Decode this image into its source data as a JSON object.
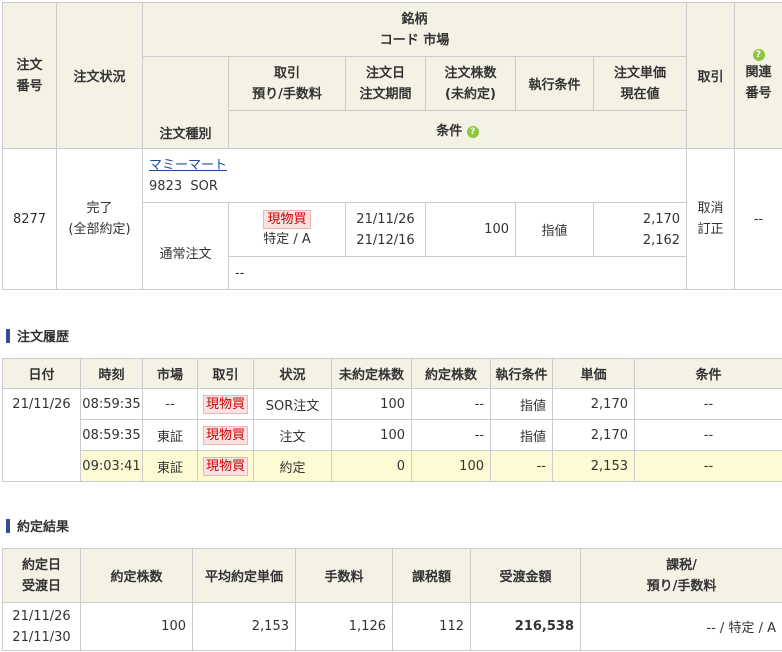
{
  "order": {
    "headers": {
      "order_no": "注文番号",
      "status": "注文状況",
      "stock": "銘柄",
      "code_market": "コード 市場",
      "order_type": "注文種別",
      "trade": "取引",
      "deposit_fee": "預り/手数料",
      "order_date": "注文日",
      "order_period": "注文期間",
      "qty": "注文株数",
      "unfilled": "(未約定)",
      "exec_cond": "執行条件",
      "unit_price": "注文単価",
      "current_price": "現在値",
      "tori": "取引",
      "related": "関連",
      "related_no": "番号",
      "conditions": "条件"
    },
    "row": {
      "order_no": "8277",
      "status": "完了",
      "status_detail": "(全部約定)",
      "stock_name": "マミーマート",
      "code": "9823",
      "market": "SOR",
      "order_type": "通常注文",
      "trade": "現物買",
      "deposit": "特定 / A",
      "order_date": "21/11/26",
      "order_period": "21/12/16",
      "qty": "100",
      "exec_cond": "指値",
      "unit_price": "2,170",
      "current_price": "2,162",
      "cancel": "取消",
      "modify": "訂正",
      "related": "--",
      "conditions": "--"
    }
  },
  "history": {
    "title": "注文履歴",
    "headers": [
      "日付",
      "時刻",
      "市場",
      "取引",
      "状況",
      "未約定株数",
      "約定株数",
      "執行条件",
      "単価",
      "条件"
    ],
    "date": "21/11/26",
    "rows": [
      {
        "time": "08:59:35",
        "market": "--",
        "trade": "現物買",
        "status": "SOR注文",
        "unfilled": "100",
        "filled": "--",
        "exec": "指値",
        "price": "2,170",
        "cond": "--"
      },
      {
        "time": "08:59:35",
        "market": "東証",
        "trade": "現物買",
        "status": "注文",
        "unfilled": "100",
        "filled": "--",
        "exec": "指値",
        "price": "2,170",
        "cond": "--"
      },
      {
        "time": "09:03:41",
        "market": "東証",
        "trade": "現物買",
        "status": "約定",
        "unfilled": "0",
        "filled": "100",
        "exec": "--",
        "price": "2,153",
        "cond": "--"
      }
    ]
  },
  "result": {
    "title": "約定結果",
    "headers": {
      "exec_date": "約定日",
      "settle_date": "受渡日",
      "qty": "約定株数",
      "avg_price": "平均約定単価",
      "fee": "手数料",
      "tax": "課税額",
      "amount": "受渡金額",
      "tax_status": "課税/",
      "deposit_fee": "預り/手数料"
    },
    "row": {
      "exec_date": "21/11/26",
      "settle_date": "21/11/30",
      "qty": "100",
      "avg_price": "2,153",
      "fee": "1,126",
      "tax": "112",
      "amount": "216,538",
      "tax_status": "-- / 特定 / A"
    }
  },
  "icons": {
    "help": "question-circle-icon",
    "section": "section-bar-icon"
  },
  "colors": {
    "header_bg": "#f3f2e5",
    "buy_bg": "#fbe1e1",
    "buy_text": "#cc0000",
    "highlight_row": "#fdfad4",
    "help_green": "#8ec63f",
    "link": "#1a4fa0"
  }
}
